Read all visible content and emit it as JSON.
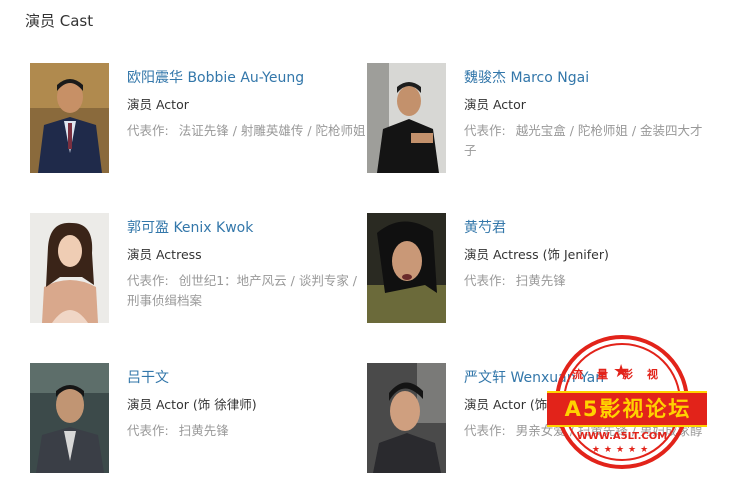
{
  "section": {
    "title": "演员 Cast"
  },
  "cast": [
    {
      "name": "欧阳震华 Bobbie Au-Yeung",
      "role": "演员 Actor",
      "works_label": "代表作:",
      "works": "法证先锋 / 射雕英雄传 / 陀枪师姐"
    },
    {
      "name": "魏骏杰 Marco Ngai",
      "role": "演员 Actor",
      "works_label": "代表作:",
      "works": "越光宝盒 / 陀枪师姐 / 金装四大才子"
    },
    {
      "name": "郭可盈 Kenix Kwok",
      "role": "演员 Actress",
      "works_label": "代表作:",
      "works": "创世纪1：地产风云 / 谈判专家 / 刑事侦缉档案"
    },
    {
      "name": "黄芍君",
      "role": "演员 Actress (饰 Jenifer)",
      "works_label": "代表作:",
      "works": "扫黄先锋"
    },
    {
      "name": "吕干文",
      "role": "演员 Actor (饰 徐律师)",
      "works_label": "代表作:",
      "works": "扫黄先锋"
    },
    {
      "name": "严文轩 Wenxuan Yan",
      "role": "演员 Actor (饰 小东)",
      "works_label": "代表作:",
      "works": "男亲女爱 / 扫黄先锋 / 男妇成家醇"
    }
  ],
  "watermark": {
    "top_text": "流量影视",
    "band_text": "A5影视论坛",
    "url": "WWW.A5LT.COM",
    "stars": "★★★★★",
    "color": "#e2231a",
    "accent": "#ffd200"
  }
}
